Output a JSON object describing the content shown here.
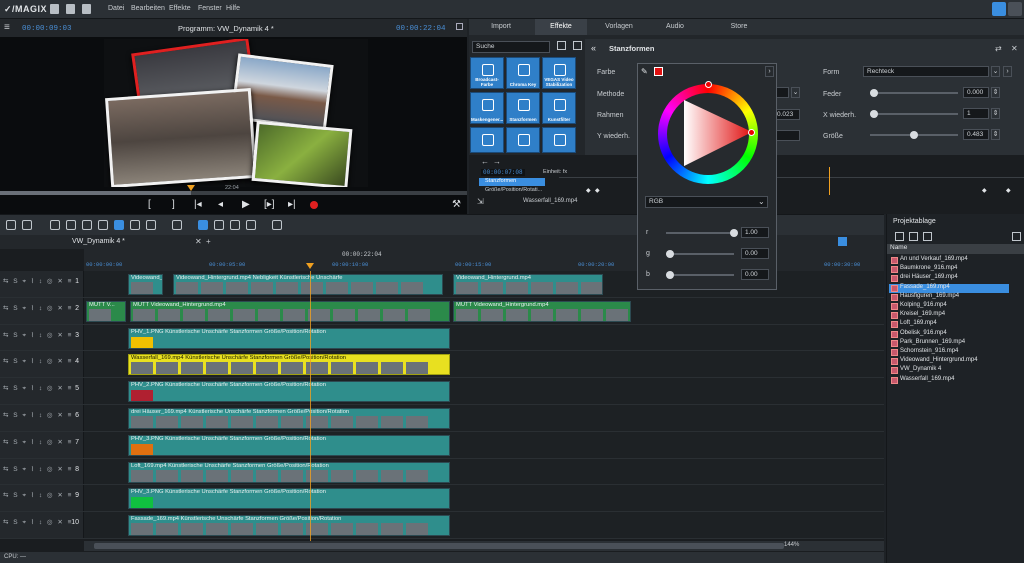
{
  "app": {
    "logo": "✓/MAGIX"
  },
  "menu": [
    "Datei",
    "Bearbeiten",
    "Effekte",
    "Fenster",
    "Hilfe"
  ],
  "program_monitor": {
    "title": "Programm: VW_Dynamik 4 *",
    "tc_left": "00:00:09:03",
    "tc_right": "00:00:22:04",
    "scrub_label": "22:04",
    "progress": 0.41
  },
  "right_panel": {
    "tabs": [
      "Import",
      "Effekte",
      "Vorlagen",
      "Audio",
      "Store"
    ],
    "active_tab": "Effekte",
    "search_placeholder": "Suche",
    "effect_tiles": [
      "Broadcast-Farbe",
      "Chroma Key",
      "VEGAS Video Stabilization",
      "Maskengener...",
      "Stanzformen",
      "Kunstfilter",
      "",
      "",
      ""
    ],
    "panel_title": "Stanzformen",
    "params_left": [
      {
        "label": "Farbe"
      },
      {
        "label": "Methode"
      },
      {
        "label": "Rahmen",
        "value": "0.023"
      },
      {
        "label": "Y wiederh."
      }
    ],
    "params_right": [
      {
        "label": "Form",
        "value": "Rechteck"
      },
      {
        "label": "Feder",
        "value": "0.000"
      },
      {
        "label": "X wiederh.",
        "value": "1"
      },
      {
        "label": "Größe",
        "value": "0.483"
      }
    ],
    "kf_tc": "00:00:07:08",
    "kf_unit": "Einheit: fx",
    "kf_tree": [
      "Stanzformen",
      "Größe/Position/Rotati..."
    ],
    "kf_clip": "Wasserfall_169.mp4"
  },
  "color_popup": {
    "mode": "RGB",
    "channels": [
      {
        "label": "r",
        "value": "1.00",
        "frac": 1.0
      },
      {
        "label": "g",
        "value": "0.00",
        "frac": 0.0
      },
      {
        "label": "b",
        "value": "0.00",
        "frac": 0.0
      }
    ],
    "color": "#e01010"
  },
  "timeline": {
    "sequence_tab": "VW_Dynamik 4 *",
    "tc_center": "00:00:22:04",
    "ruler": [
      "00:00:00:00",
      "00:00:05:00",
      "00:00:10:00",
      "00:00:15:00",
      "00:00:20:00",
      "00:00:25:00",
      "00:00:30:00"
    ],
    "tracks": [
      {
        "num": "1",
        "clips": [
          {
            "title": "Videowand_Hin...",
            "color": "#2f8e8c"
          },
          {
            "title": "Videowand_Hintergrund.mp4  Nebligkeit  Künstlerische Unschärfe",
            "color": "#2f8e8c"
          },
          {
            "title": "Videowand_Hintergrund.mp4",
            "color": "#2f8e8c"
          }
        ]
      },
      {
        "num": "2",
        "clips": [
          {
            "title": "MUTT V...",
            "color": "#2b8a4a"
          },
          {
            "title": "MUTT Videowand_Hintergrund.mp4",
            "color": "#2b8a4a"
          },
          {
            "title": "MUTT Videowand_Hintergrund.mp4",
            "color": "#2b8a4a"
          }
        ]
      },
      {
        "num": "3",
        "clips": [
          {
            "title": "PHV_1.PNG  Künstlerische Unschärfe  Stanzformen  Größe/Position/Rotation",
            "color": "#2f8e8c",
            "swatch": "#f0c000"
          }
        ]
      },
      {
        "num": "4",
        "clips": [
          {
            "title": "Wasserfall_169.mp4  Künstlerische Unschärfe  Stanzformen  Größe/Position/Rotation",
            "color": "#e8e020"
          }
        ]
      },
      {
        "num": "5",
        "clips": [
          {
            "title": "PHV_2.PNG  Künstlerische Unschärfe  Stanzformen  Größe/Position/Rotation",
            "color": "#2f8e8c",
            "swatch": "#b02030"
          }
        ]
      },
      {
        "num": "6",
        "clips": [
          {
            "title": "drei Häuser_169.mp4  Künstlerische Unschärfe  Stanzformen  Größe/Position/Rotation",
            "color": "#2f8e8c"
          }
        ]
      },
      {
        "num": "7",
        "clips": [
          {
            "title": "PHV_3.PNG  Künstlerische Unschärfe  Stanzformen  Größe/Position/Rotation",
            "color": "#2f8e8c",
            "swatch": "#e07010"
          }
        ]
      },
      {
        "num": "8",
        "clips": [
          {
            "title": "Loft_169.mp4  Künstlerische Unschärfe  Stanzformen  Größe/Position/Rotation",
            "color": "#2f8e8c"
          }
        ]
      },
      {
        "num": "9",
        "clips": [
          {
            "title": "PHV_3.PNG  Künstlerische Unschärfe  Stanzformen  Größe/Position/Rotation",
            "color": "#2f8e8c",
            "swatch": "#10c040"
          }
        ]
      },
      {
        "num": "10",
        "clips": [
          {
            "title": "Fassade_169.mp4  Künstlerische Unschärfe  Stanzformen  Größe/Position/Rotation",
            "color": "#2f8e8c"
          }
        ]
      }
    ],
    "zoom": "144%"
  },
  "project": {
    "title": "Projektablage",
    "col": "Name",
    "items": [
      "An und Verkauf_169.mp4",
      "Baumkrone_916.mp4",
      "drei Häuser_169.mp4",
      "Fassade_169.mp4",
      "Hausfiguren_169.mp4",
      "Kolping_916.mp4",
      "Kreisel_169.mp4",
      "Loft_169.mp4",
      "Obelisk_916.mp4",
      "Park_Brunnen_169.mp4",
      "Schornstein_916.mp4",
      "Videowand_Hintergrund.mp4",
      "VW_Dynamik 4",
      "Wasserfall_169.mp4"
    ],
    "selected": "Fassade_169.mp4"
  },
  "status": {
    "cpu": "CPU: —"
  }
}
